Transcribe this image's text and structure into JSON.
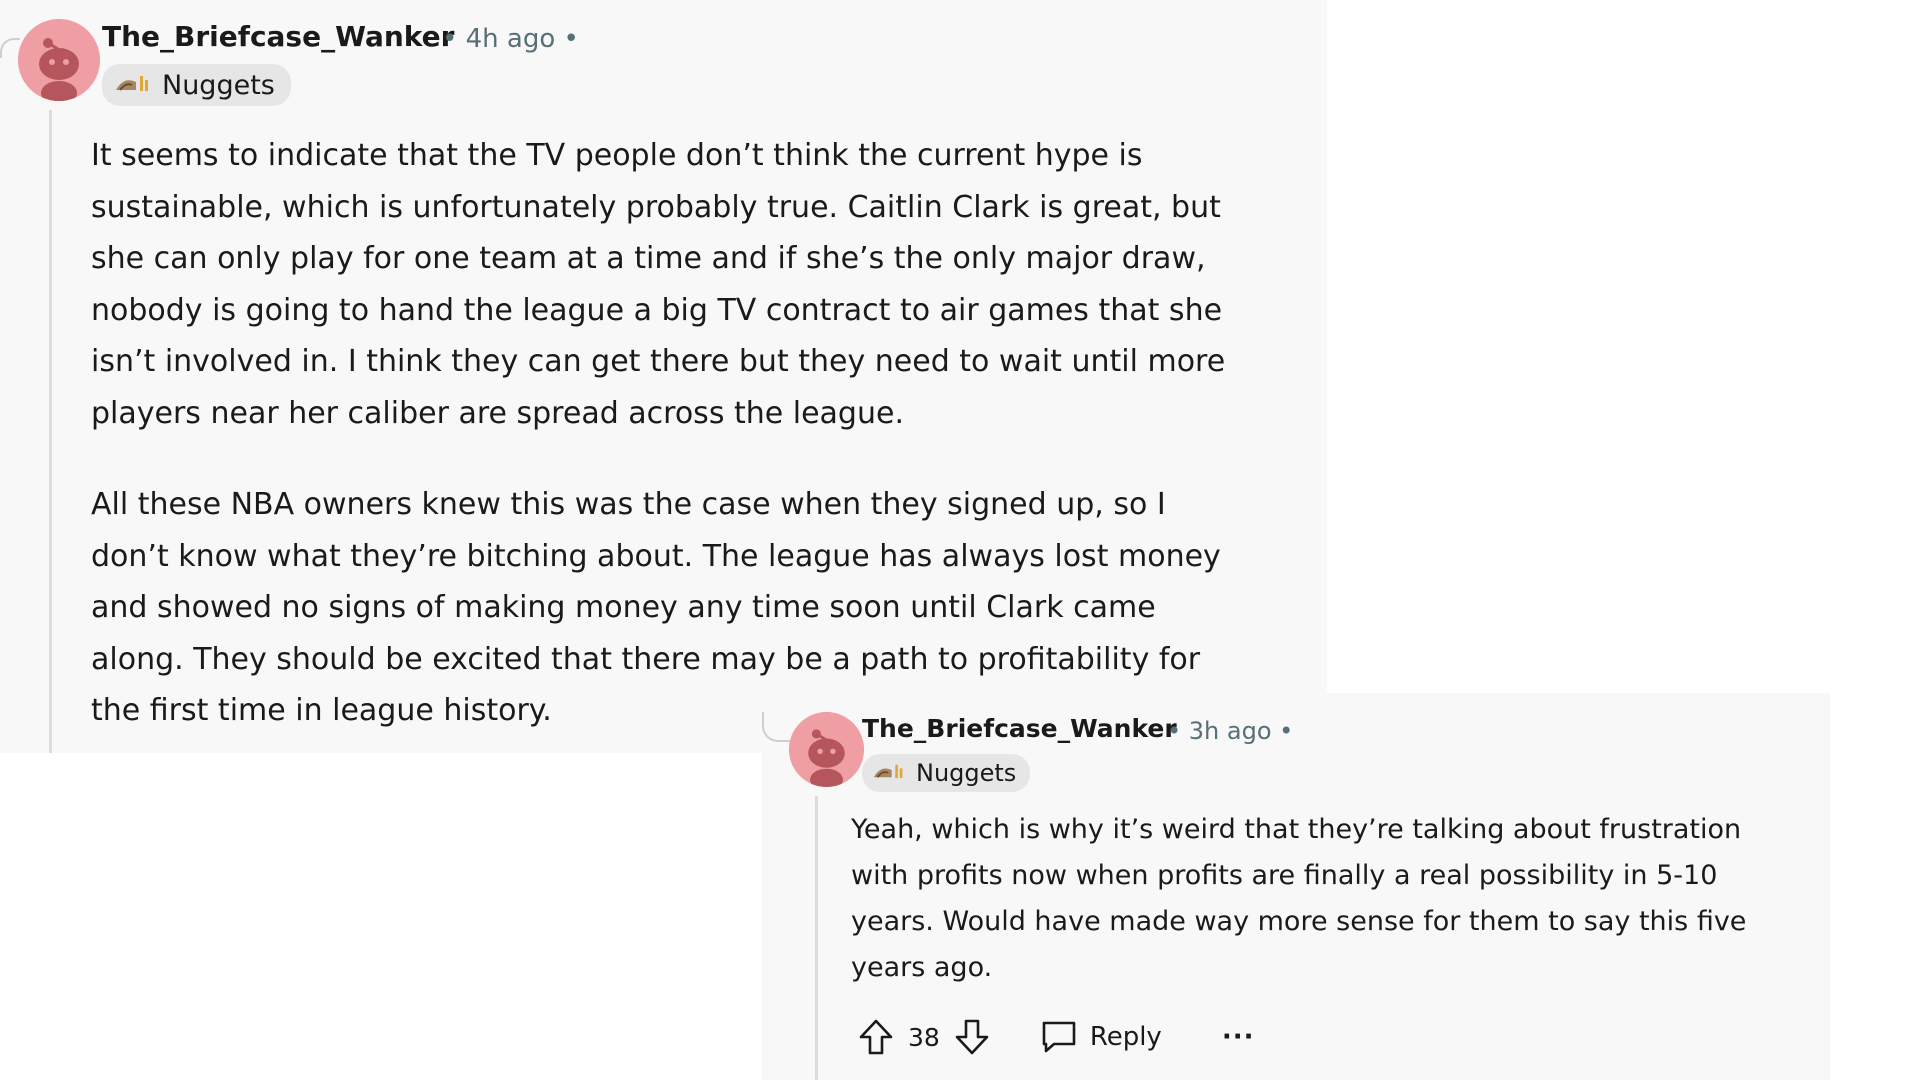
{
  "comments": [
    {
      "author": "The_Briefcase_Wanker",
      "meta": "• 4h ago •",
      "flair": "Nuggets",
      "paragraph1": [
        "It seems to indicate that the TV people don’t think the current hype is",
        "sustainable, which is unfortunately probably true. Caitlin Clark is great, but",
        "she can only play for one team at a time and if she’s the only major draw,",
        "nobody is going to hand the league a big TV contract to air games that she",
        "isn’t involved in. I think they can get there but they need to wait until more",
        "players near her caliber are spread across the league."
      ],
      "paragraph2": [
        "All these NBA owners knew this was the case when they signed up, so I",
        "don’t know what they’re bitching about. The league has always lost money",
        "and showed no signs of making money any time soon until Clark came",
        "along. They should be excited that there may be a path to profitability for",
        "the first time in league history."
      ]
    },
    {
      "author": "The_Briefcase_Wanker",
      "meta": "• 3h ago •",
      "flair": "Nuggets",
      "paragraph1": [
        "Yeah, which is why it’s weird that they’re talking about frustration",
        "with profits now when profits are finally a real possibility in 5-10",
        "years. Would have made way more sense for them to say this five",
        "years ago."
      ],
      "actions": {
        "vote_count": "38",
        "reply_label": "Reply",
        "more_label": "···"
      }
    }
  ],
  "icons": {
    "upvote": "upvote-arrow-icon",
    "downvote": "downvote-arrow-icon",
    "reply": "speech-bubble-icon",
    "more": "ellipsis-icon",
    "avatar": "snoo-avatar-icon",
    "flair": "team-flair-icon"
  },
  "colors": {
    "avatar_bg": "#ef9ea3",
    "card_bg": "#f8f8f8",
    "meta_text": "#576f76",
    "flair_bg": "#e6e6e6"
  }
}
